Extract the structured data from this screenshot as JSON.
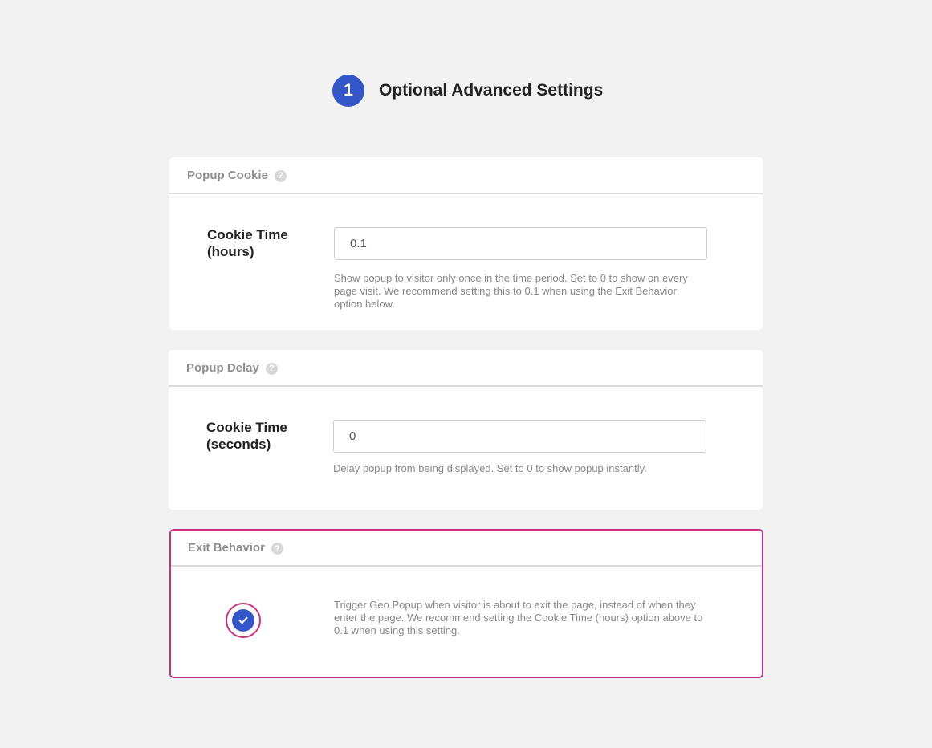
{
  "header": {
    "step_number": "1",
    "title": "Optional Advanced Settings"
  },
  "cards": {
    "popup_cookie": {
      "title": "Popup Cookie",
      "help": "?",
      "field_label": "Cookie Time (hours)",
      "input_value": "0.1",
      "help_text": "Show popup to visitor only once in the time period. Set to 0 to show on every page visit. We recommend setting this to 0.1 when using the Exit Behavior option below."
    },
    "popup_delay": {
      "title": "Popup Delay",
      "help": "?",
      "field_label": "Cookie Time (seconds)",
      "input_value": "0",
      "help_text": "Delay popup from being displayed. Set to 0 to show popup instantly."
    },
    "exit_behavior": {
      "title": "Exit Behavior",
      "help": "?",
      "checked": true,
      "help_text": "Trigger Geo Popup when visitor is about to exit the page, instead of when they enter the page. We recommend setting the Cookie Time (hours) option above to 0.1 when using this setting."
    }
  },
  "colors": {
    "accent": "#3556c8",
    "highlight": "#c7327f",
    "background": "#f2f2f2"
  },
  "icons": {
    "help": "question-mark-icon",
    "check": "checkmark-icon"
  }
}
